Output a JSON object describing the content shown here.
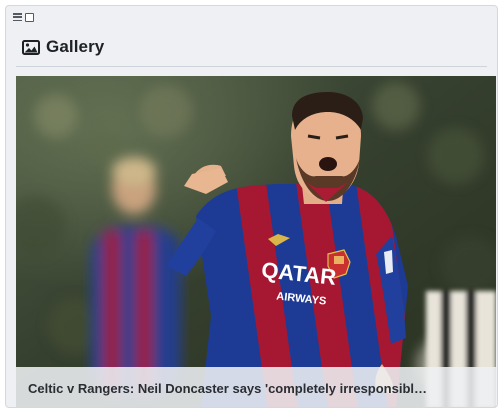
{
  "widget": {
    "title": "Gallery",
    "icon": "image-icon",
    "controls": [
      "menu-icon",
      "checkbox-icon"
    ]
  },
  "slide": {
    "caption": "Celtic v Rangers: Neil Doncaster says 'completely irresponsible' t...",
    "image": "footballer-celebrating-photo",
    "shirt_text": {
      "sponsor_line1": "QATAR",
      "sponsor_line2": "AIRWAYS"
    }
  },
  "colors": {
    "panel_bg": "#eef0f3",
    "shirt_blue": "#1f3f9e",
    "shirt_red": "#b11a36",
    "caption_bg": "#eef0f3"
  }
}
